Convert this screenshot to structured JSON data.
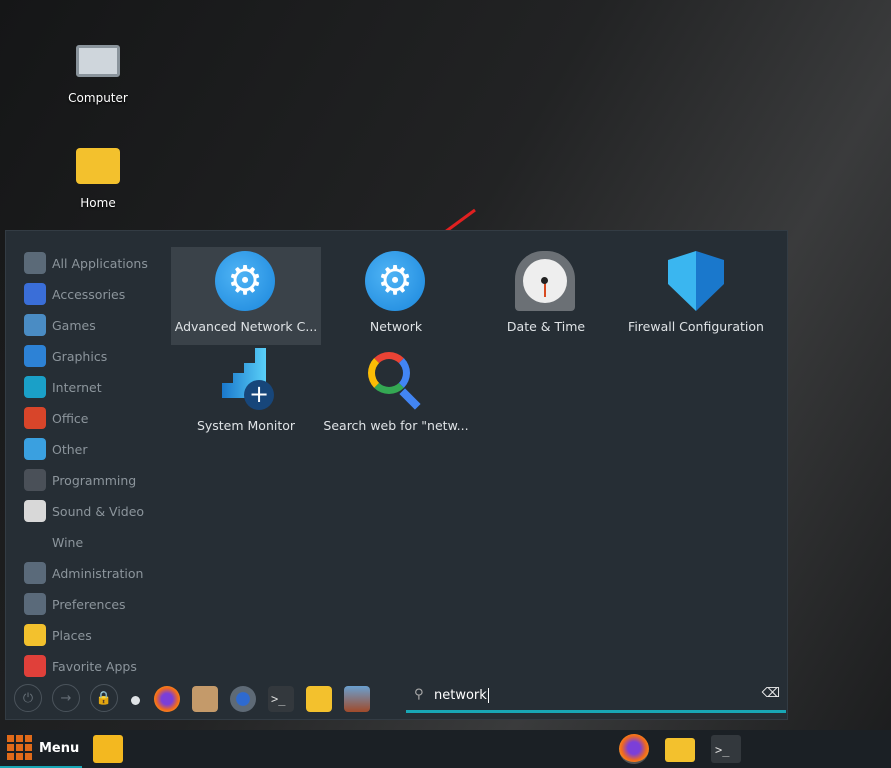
{
  "desktop": {
    "icons": [
      {
        "label": "Computer",
        "icon": "computer-icon"
      },
      {
        "label": "Home",
        "icon": "home-folder-icon"
      }
    ]
  },
  "menu": {
    "categories": [
      {
        "label": "All Applications",
        "icon": "all-applications-icon",
        "color": "#5b6a78"
      },
      {
        "label": "Accessories",
        "icon": "accessories-icon",
        "color": "#3a6ed8"
      },
      {
        "label": "Games",
        "icon": "games-icon",
        "color": "#4a8cc4"
      },
      {
        "label": "Graphics",
        "icon": "graphics-icon",
        "color": "#2d82d6"
      },
      {
        "label": "Internet",
        "icon": "internet-icon",
        "color": "#1aa0c8"
      },
      {
        "label": "Office",
        "icon": "office-icon",
        "color": "#d8452a"
      },
      {
        "label": "Other",
        "icon": "other-icon",
        "color": "#3aa0e0"
      },
      {
        "label": "Programming",
        "icon": "programming-icon",
        "color": "#4a5058"
      },
      {
        "label": "Sound & Video",
        "icon": "sound-video-icon",
        "color": "#d8d8d8"
      },
      {
        "label": "Wine",
        "icon": "wine-icon",
        "color": "transparent"
      },
      {
        "label": "Administration",
        "icon": "administration-icon",
        "color": "#5a6a7a"
      },
      {
        "label": "Preferences",
        "icon": "preferences-icon",
        "color": "#5a6a7a"
      },
      {
        "label": "Places",
        "icon": "places-folder-icon",
        "color": "#f3c12d"
      },
      {
        "label": "Favorite Apps",
        "icon": "heart-icon",
        "color": "#e0403a"
      }
    ],
    "results": [
      {
        "label": "Advanced Network C...",
        "icon": "network-settings-icon",
        "selected": true
      },
      {
        "label": "Network",
        "icon": "network-icon"
      },
      {
        "label": "Date & Time",
        "icon": "clock-icon"
      },
      {
        "label": "Firewall Configuration",
        "icon": "firewall-shield-icon"
      },
      {
        "label": "System Monitor",
        "icon": "system-monitor-icon"
      },
      {
        "label": "Search web for \"netw...",
        "icon": "web-search-icon"
      }
    ],
    "search": {
      "value": "network",
      "icon": "search-icon",
      "clear_icon": "clear-backspace-icon",
      "accent": "#18a7b6"
    },
    "session_buttons": [
      "power-icon",
      "logout-icon",
      "lock-icon"
    ],
    "favorites": [
      "firefox-icon",
      "archive-manager-icon",
      "settings-icon",
      "terminal-icon",
      "files-folder-icon",
      "image-viewer-icon"
    ]
  },
  "taskbar": {
    "menu_label": "Menu",
    "menu_color": "#e06a1a"
  }
}
